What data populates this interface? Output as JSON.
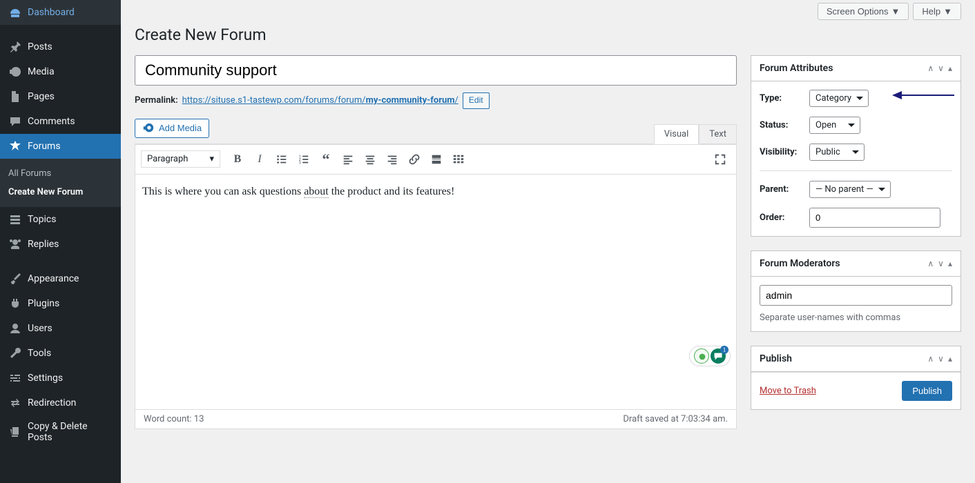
{
  "topbar": {
    "screen_options": "Screen Options",
    "help": "Help"
  },
  "sidebar": {
    "items": [
      {
        "name": "dashboard",
        "label": "Dashboard"
      },
      {
        "name": "posts",
        "label": "Posts"
      },
      {
        "name": "media",
        "label": "Media"
      },
      {
        "name": "pages",
        "label": "Pages"
      },
      {
        "name": "comments",
        "label": "Comments"
      },
      {
        "name": "forums",
        "label": "Forums"
      },
      {
        "name": "topics",
        "label": "Topics"
      },
      {
        "name": "replies",
        "label": "Replies"
      },
      {
        "name": "appearance",
        "label": "Appearance"
      },
      {
        "name": "plugins",
        "label": "Plugins"
      },
      {
        "name": "users",
        "label": "Users"
      },
      {
        "name": "tools",
        "label": "Tools"
      },
      {
        "name": "settings",
        "label": "Settings"
      },
      {
        "name": "redirection",
        "label": "Redirection"
      },
      {
        "name": "copy-delete-posts",
        "label": "Copy & Delete Posts"
      }
    ],
    "sub": [
      {
        "label": "All Forums",
        "current": false
      },
      {
        "label": "Create New Forum",
        "current": true
      }
    ]
  },
  "page": {
    "title": "Create New Forum"
  },
  "editor": {
    "title_value": "Community support",
    "permalink_label": "Permalink:",
    "permalink_base": "https://situse.s1-tastewp.com/forums/forum/",
    "permalink_slug": "my-community-forum",
    "permalink_suffix": "/",
    "edit_btn": "Edit",
    "add_media": "Add Media",
    "tabs": {
      "visual": "Visual",
      "text": "Text"
    },
    "format": "Paragraph",
    "body_pre": "This is where you can ask questions ",
    "body_dotted": "about",
    "body_post": " the product and its features!",
    "word_count_label": "Word count: ",
    "word_count_value": "13",
    "draft_saved": "Draft saved at 7:03:34 am."
  },
  "attributes": {
    "heading": "Forum Attributes",
    "type_label": "Type:",
    "type_value": "Category",
    "status_label": "Status:",
    "status_value": "Open",
    "visibility_label": "Visibility:",
    "visibility_value": "Public",
    "parent_label": "Parent:",
    "parent_value": "— No parent —",
    "order_label": "Order:",
    "order_value": "0"
  },
  "moderators": {
    "heading": "Forum Moderators",
    "value": "admin",
    "hint": "Separate user-names with commas"
  },
  "publish": {
    "heading": "Publish",
    "trash": "Move to Trash",
    "button": "Publish"
  },
  "floaty_badge": "1"
}
